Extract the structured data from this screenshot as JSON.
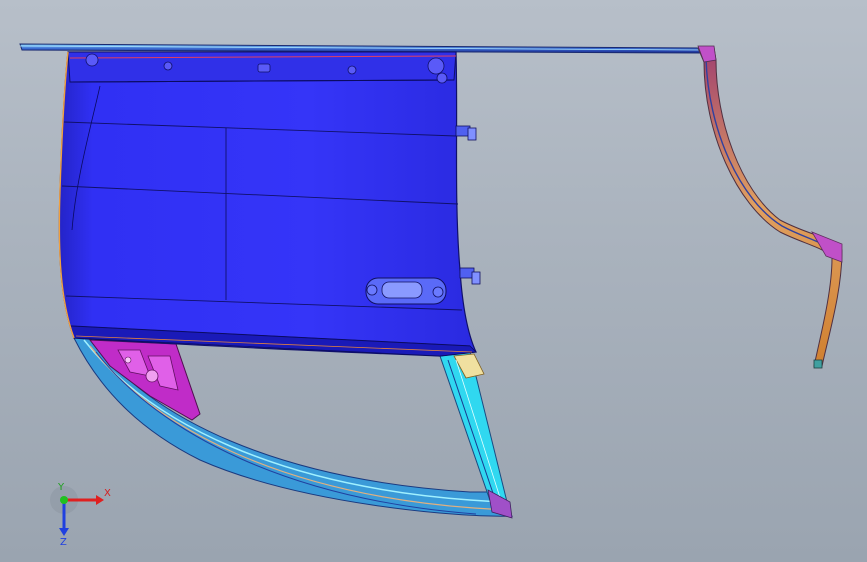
{
  "viewport": {
    "background_top": "#b7bfc9",
    "background_bottom": "#9aa4b0"
  },
  "model": {
    "panel_color": "#2f2ff0",
    "edge_color": "#1a1a7a",
    "accent_magenta": "#d43ad8",
    "accent_cyan": "#38d0e8",
    "accent_orange": "#e0a040"
  },
  "triad": {
    "x_label": "X",
    "y_label": "Y",
    "z_label": "Z",
    "x_color": "#e02020",
    "y_color": "#20c020",
    "z_color": "#2040e0"
  }
}
